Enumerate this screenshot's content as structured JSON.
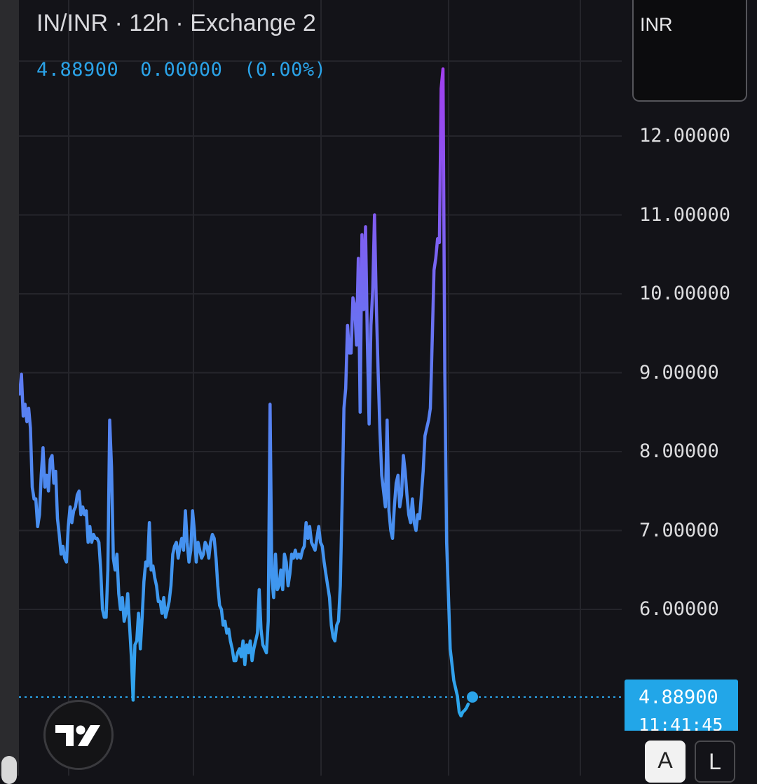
{
  "header": {
    "symbol": "IN/INR",
    "interval": "12h",
    "exchange": "Exchange 2",
    "last_price": "4.88900",
    "change": "0.00000",
    "change_pct": "(0.00%)"
  },
  "currency_label": "INR",
  "price_tag": {
    "price": "4.88900",
    "countdown": "11:41:45"
  },
  "scale_buttons": {
    "auto": "A",
    "log": "L"
  },
  "colors": {
    "background": "#131318",
    "accent": "#2ba3e8",
    "line_low": "#2aa9ec",
    "line_mid": "#5a7ff2",
    "line_high": "#a23ff0"
  },
  "icons": {
    "logo": "tradingview-logo-icon"
  },
  "chart_data": {
    "type": "line",
    "title": "IN/INR · 12h · Exchange 2",
    "y_ticks": [
      "12.00000",
      "11.00000",
      "10.00000",
      "9.00000",
      "8.00000",
      "7.00000",
      "6.00000"
    ],
    "y_tick_values": [
      12,
      11,
      10,
      9,
      8,
      7,
      6
    ],
    "ylim": [
      4.3,
      13.3
    ],
    "x_count": 290,
    "current_value": 4.889,
    "grid": true,
    "legend": "none",
    "series": [
      {
        "values": [
          8.73,
          8.98,
          8.45,
          8.6,
          8.38,
          8.55,
          8.3,
          7.55,
          7.4,
          7.4,
          7.05,
          7.2,
          7.7,
          8.05,
          7.55,
          7.7,
          7.5,
          7.9,
          7.95,
          7.6,
          7.75,
          7.15,
          6.95,
          6.7,
          6.8,
          6.65,
          6.6,
          7.05,
          7.3,
          7.1,
          7.25,
          7.3,
          7.45,
          7.5,
          7.2,
          7.3,
          7.2,
          7.25,
          6.85,
          7.05,
          6.85,
          6.95,
          6.9,
          6.9,
          6.85,
          6.5,
          6.0,
          5.9,
          5.9,
          6.5,
          8.4,
          7.8,
          6.65,
          6.5,
          6.7,
          6.2,
          6.0,
          6.15,
          5.85,
          5.95,
          6.2,
          5.8,
          5.4,
          4.85,
          5.55,
          5.6,
          5.95,
          5.5,
          5.9,
          6.35,
          6.6,
          6.55,
          7.1,
          6.5,
          6.55,
          6.4,
          6.3,
          6.1,
          6.1,
          5.95,
          6.15,
          5.9,
          6.0,
          6.1,
          6.3,
          6.7,
          6.8,
          6.85,
          6.65,
          6.8,
          6.9,
          6.75,
          7.25,
          6.85,
          6.6,
          6.75,
          7.25,
          7.0,
          6.6,
          6.85,
          6.75,
          6.65,
          6.7,
          6.85,
          6.8,
          6.65,
          6.85,
          6.95,
          6.9,
          6.65,
          6.3,
          6.05,
          6.0,
          5.8,
          5.85,
          5.7,
          5.75,
          5.6,
          5.5,
          5.35,
          5.35,
          5.45,
          5.5,
          5.4,
          5.6,
          5.3,
          5.55,
          5.45,
          5.6,
          5.35,
          5.5,
          5.6,
          5.7,
          6.25,
          5.75,
          5.55,
          5.5,
          5.45,
          5.85,
          8.6,
          6.4,
          6.15,
          6.7,
          6.25,
          6.3,
          6.5,
          6.25,
          6.7,
          6.6,
          6.3,
          6.45,
          6.7,
          6.65,
          6.75,
          6.65,
          6.7,
          6.65,
          6.75,
          6.8,
          7.1,
          6.9,
          7.05,
          6.85,
          6.8,
          6.75,
          6.9,
          7.05,
          6.85,
          6.8,
          6.6,
          6.45,
          6.3,
          6.15,
          5.8,
          5.65,
          5.6,
          5.8,
          5.85,
          6.3,
          7.35,
          8.55,
          8.8,
          9.6,
          9.25,
          9.25,
          9.95,
          9.85,
          9.35,
          10.45,
          8.5,
          10.75,
          9.8,
          10.85,
          9.4,
          8.35,
          9.6,
          10.05,
          11.0,
          9.85,
          9.0,
          8.25,
          7.7,
          7.5,
          7.3,
          8.4,
          7.25,
          7.0,
          6.9,
          7.3,
          7.6,
          7.7,
          7.3,
          7.45,
          7.95,
          7.75,
          7.45,
          7.2,
          7.1,
          7.4,
          7.1,
          7.0,
          7.2,
          7.15,
          7.45,
          7.75,
          8.2,
          8.3,
          8.4,
          8.55,
          9.4,
          10.3,
          10.45,
          10.7,
          10.65,
          12.6,
          12.85,
          9.0,
          6.85,
          6.2,
          5.5,
          5.3,
          5.1,
          5.0,
          4.9,
          4.7,
          4.65,
          4.7,
          4.72,
          4.75,
          4.8
        ],
        "x": [
          0,
          1,
          2,
          3,
          4,
          5,
          6,
          7,
          8,
          9,
          10,
          11,
          12,
          13,
          14,
          15,
          16,
          17,
          18,
          19,
          20,
          21,
          22,
          23,
          24,
          25,
          26,
          27,
          28,
          29,
          30,
          31,
          32,
          33,
          34,
          35,
          36,
          37,
          38,
          39,
          40,
          41,
          42,
          43,
          44,
          45,
          46,
          47,
          48,
          49,
          50,
          51,
          52,
          53,
          54,
          55,
          56,
          57,
          58,
          59,
          60,
          61,
          62,
          63,
          64,
          65,
          66,
          67,
          68,
          69,
          70,
          71,
          72,
          73,
          74,
          75,
          76,
          77,
          78,
          79,
          80,
          81,
          82,
          83,
          84,
          85,
          86,
          87,
          88,
          89,
          90,
          91,
          92,
          93,
          94,
          95,
          96,
          97,
          98,
          99,
          100,
          101,
          102,
          103,
          104,
          105,
          106,
          107,
          108,
          109,
          110,
          111,
          112,
          113,
          114,
          115,
          116,
          117,
          118,
          119,
          120,
          121,
          122,
          123,
          124,
          125,
          126,
          127,
          128,
          129,
          130,
          131,
          132,
          133,
          134,
          135,
          136,
          137,
          138,
          139,
          140,
          141,
          142,
          143,
          144,
          145,
          146,
          147,
          148,
          149,
          150,
          151,
          152,
          153,
          154,
          155,
          156,
          157,
          158,
          159,
          160,
          161,
          162,
          163,
          164,
          165,
          166,
          167,
          168,
          169,
          170,
          171,
          172,
          173,
          174,
          175,
          176,
          177,
          178,
          179,
          180,
          181,
          182,
          183,
          184,
          185,
          186,
          187,
          188,
          189,
          190,
          191,
          192,
          193,
          194,
          195,
          196,
          197,
          198,
          199,
          200,
          201,
          202,
          203,
          204,
          205,
          206,
          207,
          208,
          209,
          210,
          211,
          212,
          213,
          214,
          215,
          216,
          217,
          218,
          219,
          220,
          221,
          222,
          223,
          224,
          225,
          226,
          227,
          228,
          229,
          230,
          231,
          232,
          233,
          234,
          235,
          236,
          237,
          238,
          239,
          240,
          241,
          242,
          243,
          244,
          245,
          246,
          247,
          248,
          249
        ]
      }
    ]
  }
}
